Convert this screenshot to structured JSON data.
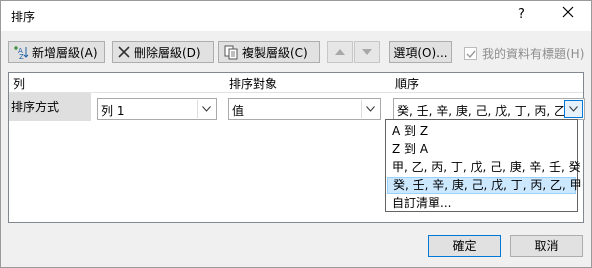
{
  "window": {
    "title": "排序",
    "help": "?"
  },
  "toolbar": {
    "add_level": "新增層級(A)",
    "delete_level": "刪除層級(D)",
    "copy_level": "複製層級(C)",
    "options": "選項(O)...",
    "has_headers_label": "我的資料有標題(H)",
    "has_headers_checked": true
  },
  "grid": {
    "headers": {
      "column": "列",
      "sort_on": "排序對象",
      "order": "順序"
    },
    "row": {
      "label": "排序方式",
      "column_value": "列 1",
      "sort_on_value": "值",
      "order_value": "癸, 壬, 辛, 庚, 己, 戊, 丁, 丙, 乙, 甲"
    }
  },
  "order_dropdown": {
    "options": [
      "A 到 Z",
      "Z 到 A",
      "甲, 乙, 丙, 丁, 戊, 己, 庚, 辛, 壬, 癸",
      "癸, 壬, 辛, 庚, 己, 戊, 丁, 丙, 乙, 甲",
      "自訂清單..."
    ],
    "selected_index": 3
  },
  "buttons": {
    "ok": "確定",
    "cancel": "取消"
  },
  "colors": {
    "selection": "#cce8ff",
    "accent": "#0078d7"
  }
}
